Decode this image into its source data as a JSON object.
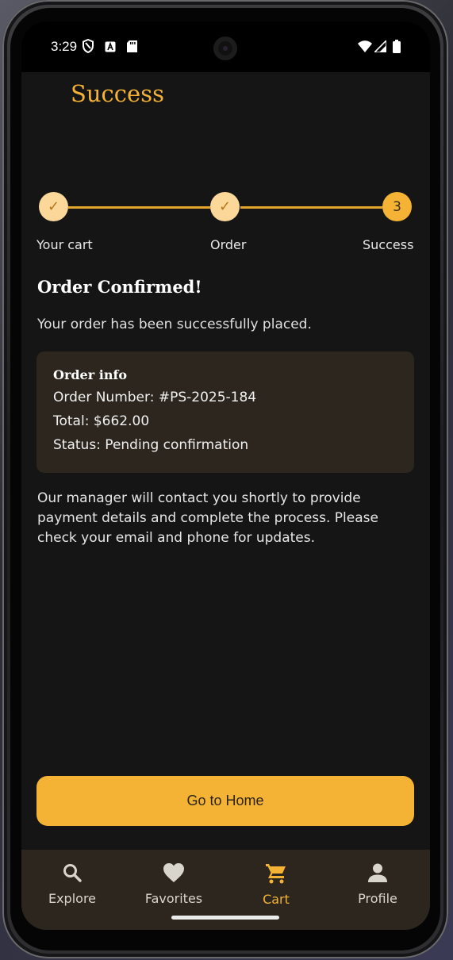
{
  "status_bar": {
    "time": "3:29",
    "left_icons": [
      "shield-icon",
      "a-icon",
      "sd-card-icon"
    ],
    "right_icons": [
      "wifi-icon",
      "signal-icon",
      "battery-icon"
    ]
  },
  "app_bar": {
    "title": "Success"
  },
  "stepper": {
    "steps": [
      {
        "label": "Your cart",
        "state": "done",
        "marker": "✓"
      },
      {
        "label": "Order",
        "state": "done",
        "marker": "✓"
      },
      {
        "label": "Success",
        "state": "current",
        "marker": "3"
      }
    ],
    "colors": {
      "accent": "#F5B335",
      "done_fill": "#FCD79A",
      "line": "#E3A52C"
    }
  },
  "confirmation": {
    "title": "Order Confirmed!",
    "subtitle": "Your order has been successfully placed."
  },
  "order_info": {
    "title": "Order info",
    "order_number": "Order Number: #PS-2025-184",
    "total": "Total: $662.00",
    "status": "Status: Pending confirmation"
  },
  "notice": "Our manager will contact you shortly to provide payment details and complete the process. Please check your email and phone for updates.",
  "actions": {
    "go_home": "Go to Home"
  },
  "bottom_nav": {
    "items": [
      {
        "label": "Explore",
        "icon": "search-icon",
        "active": false
      },
      {
        "label": "Favorites",
        "icon": "heart-icon",
        "active": false
      },
      {
        "label": "Cart",
        "icon": "cart-icon",
        "active": true
      },
      {
        "label": "Profile",
        "icon": "person-icon",
        "active": false
      }
    ]
  },
  "theme": {
    "background": "#151515",
    "card": "#2C261E",
    "accent": "#F5B335"
  }
}
